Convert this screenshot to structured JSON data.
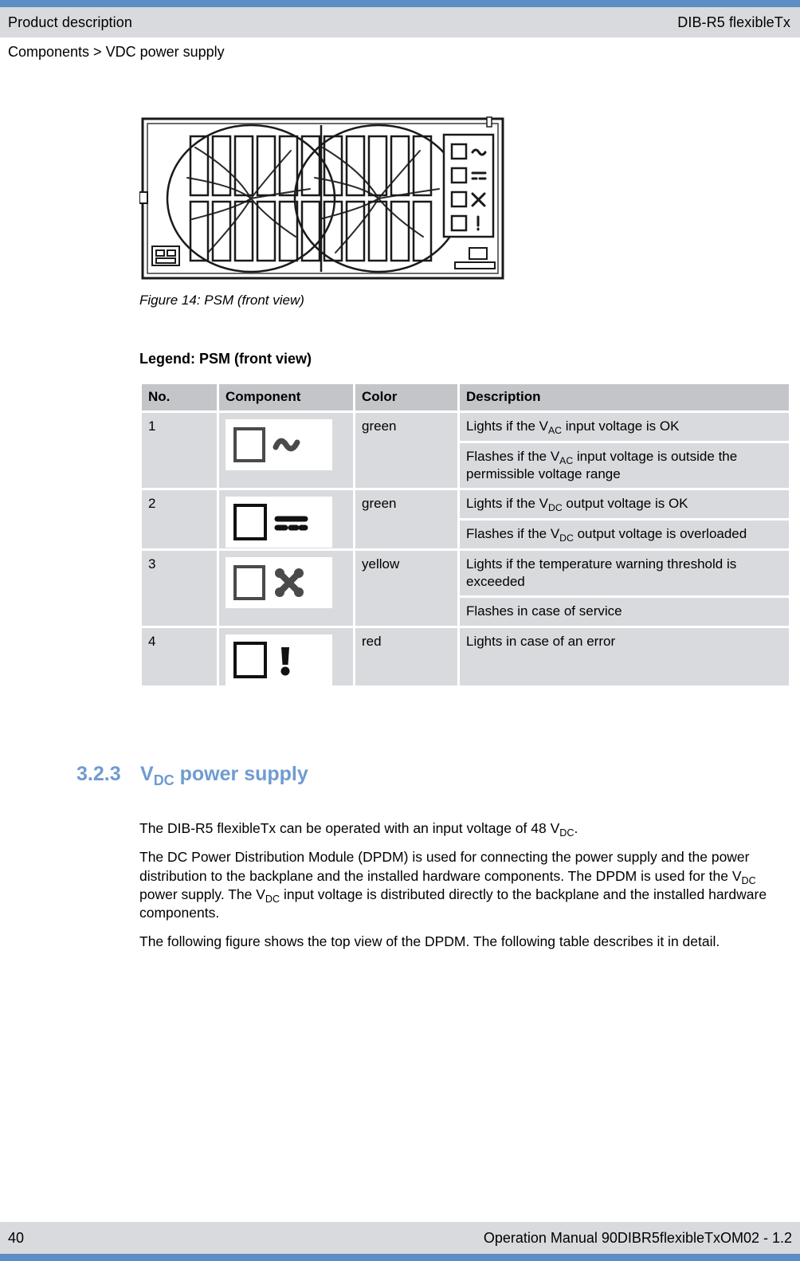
{
  "header": {
    "left_title": "Product description",
    "right_title": "DIB-R5 flexibleTx",
    "breadcrumb": "Components > VDC power supply",
    "accent_color": "#5b8ec4",
    "band_color": "#d9dadd"
  },
  "figure": {
    "caption": "Figure 14: PSM (front view)",
    "alt_name": "psm-front-view-drawing"
  },
  "legend": {
    "title": "Legend: PSM (front view)",
    "columns": [
      "No.",
      "Component",
      "Color",
      "Description"
    ],
    "rows": [
      {
        "no": "1",
        "icon": "led-ac-wave-icon",
        "color": "green",
        "descriptions": [
          {
            "pre": "Lights if the V",
            "sub": "AC",
            "post": " input voltage is OK"
          },
          {
            "pre": "Flashes if the V",
            "sub": "AC",
            "post": " input voltage is outside the permissible voltage range"
          }
        ]
      },
      {
        "no": "2",
        "icon": "led-dc-bars-icon",
        "color": "green",
        "descriptions": [
          {
            "pre": "Lights if the V",
            "sub": "DC",
            "post": " output voltage is OK"
          },
          {
            "pre": "Flashes if the V",
            "sub": "DC",
            "post": " output voltage is overloaded"
          }
        ]
      },
      {
        "no": "3",
        "icon": "led-service-tools-icon",
        "color": "yellow",
        "descriptions": [
          {
            "pre": "Lights if the temperature warning threshold is exceeded",
            "sub": "",
            "post": ""
          },
          {
            "pre": "Flashes in case of service",
            "sub": "",
            "post": ""
          }
        ]
      },
      {
        "no": "4",
        "icon": "led-error-exclamation-icon",
        "color": "red",
        "descriptions": [
          {
            "pre": "Lights in case of an error",
            "sub": "",
            "post": ""
          }
        ]
      }
    ]
  },
  "section": {
    "number": "3.2.3",
    "title_pre": "V",
    "title_sub": "DC",
    "title_post": " power supply",
    "heading_color": "#6f9bd1"
  },
  "body": {
    "p1": {
      "pre": "The DIB-R5 flexibleTx can be operated with an input voltage of 48 V",
      "sub": "DC",
      "post": "."
    },
    "p2": {
      "s1": "The DC Power Distribution Module (DPDM) is used for connecting the power supply and the power distribution to the backplane and the installed hardware components. The DPDM is used for the V",
      "sub1": "DC",
      "s2": " power supply. The V",
      "sub2": "DC",
      "s3": " input voltage is distributed directly to the backplane and the installed hardware components."
    },
    "p3": "The following figure shows the top view of the DPDM. The following table describes it in detail."
  },
  "footer": {
    "page_number": "40",
    "manual_reference": "Operation Manual 90DIBR5flexibleTxOM02 - 1.2"
  }
}
